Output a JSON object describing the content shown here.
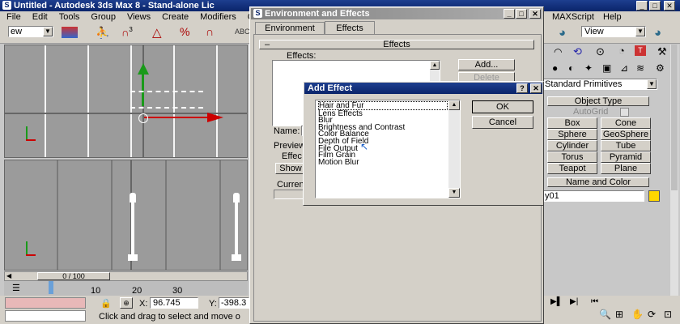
{
  "main_window": {
    "title": "Untitled - Autodesk 3ds Max 8 - Stand-alone Lic",
    "menu": [
      "File",
      "Edit",
      "Tools",
      "Group",
      "Views",
      "Create",
      "Modifiers",
      "C"
    ],
    "menu_right": [
      "MAXScript",
      "Help"
    ],
    "view_dropdown_left": "ew",
    "view_dropdown_right": "View"
  },
  "command_panel": {
    "dropdown": "Standard Primitives",
    "object_type_header": "Object Type",
    "autogrid_label": "AutoGrid",
    "buttons": [
      "Box",
      "Cone",
      "Sphere",
      "GeoSphere",
      "Cylinder",
      "Tube",
      "Torus",
      "Pyramid",
      "Teapot",
      "Plane"
    ],
    "name_color_header": "Name and Color",
    "name_value": "y01",
    "color_swatch": "#ffd700"
  },
  "timeline": {
    "frame_label": "0 / 100",
    "ticks": [
      "10",
      "20",
      "30"
    ]
  },
  "status": {
    "x_label": "X:",
    "x_value": "96.745",
    "y_label": "Y:",
    "y_value": "-398.3",
    "prompt": "Click and drag to select and move o"
  },
  "env_dialog": {
    "title": "Environment and Effects",
    "tabs": [
      "Environment",
      "Effects"
    ],
    "rollout": "Effects",
    "effects_label": "Effects:",
    "add_label": "Add...",
    "delete_label": "Delete",
    "name_label": "Name:",
    "preview_label": "Preview",
    "effect_label": "Effec",
    "show_label": "Show",
    "current_label": "Curren"
  },
  "add_effect": {
    "title": "Add Effect",
    "help": "?",
    "close": "✕",
    "ok": "OK",
    "cancel": "Cancel",
    "items": [
      "Hair and Fur",
      "Lens Effects",
      "Blur",
      "Brightness and Contrast",
      "Color Balance",
      "Depth of Field",
      "File Output",
      "Film Grain",
      "Motion Blur"
    ]
  },
  "accent": "#0a246a"
}
